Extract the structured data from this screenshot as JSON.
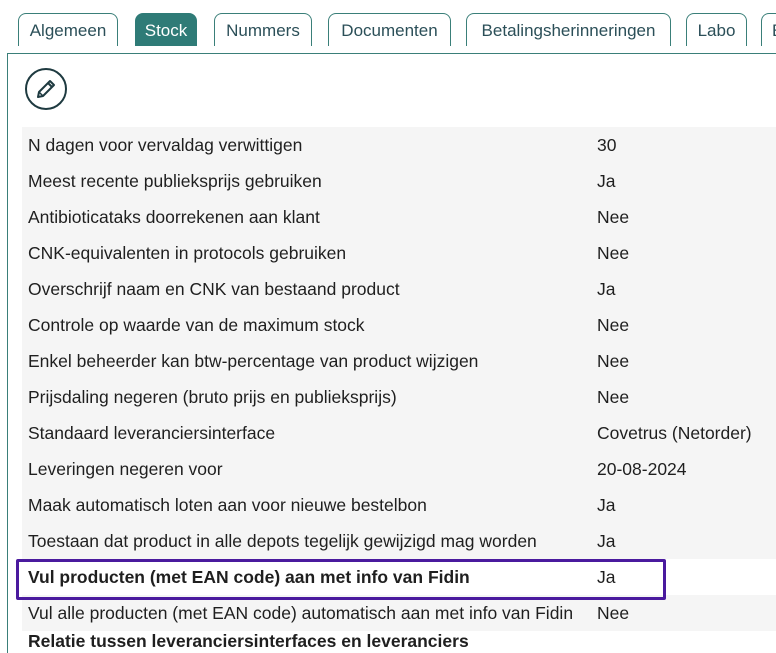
{
  "tabs": [
    {
      "label": "Algemeen",
      "active": false
    },
    {
      "label": "Stock",
      "active": true
    },
    {
      "label": "Nummers",
      "active": false
    },
    {
      "label": "Documenten",
      "active": false
    },
    {
      "label": "Betalingsherinneringen",
      "active": false
    },
    {
      "label": "Labo",
      "active": false
    },
    {
      "label": "E",
      "active": false
    }
  ],
  "edit_icon": "pencil-icon",
  "settings": [
    {
      "label": "N dagen voor vervaldag verwittigen",
      "value": "30"
    },
    {
      "label": "Meest recente publieksprijs gebruiken",
      "value": "Ja"
    },
    {
      "label": "Antibioticataks doorrekenen aan klant",
      "value": "Nee"
    },
    {
      "label": "CNK-equivalenten in protocols gebruiken",
      "value": "Nee"
    },
    {
      "label": "Overschrijf naam en CNK van bestaand product",
      "value": "Ja"
    },
    {
      "label": "Controle op waarde van de maximum stock",
      "value": "Nee"
    },
    {
      "label": "Enkel beheerder kan btw-percentage van product wijzigen",
      "value": "Nee"
    },
    {
      "label": "Prijsdaling negeren (bruto prijs en publieksprijs)",
      "value": "Nee"
    },
    {
      "label": "Standaard leveranciersinterface",
      "value": "Covetrus (Netorder)"
    },
    {
      "label": "Leveringen negeren voor",
      "value": "20-08-2024"
    },
    {
      "label": "Maak automatisch loten aan voor nieuwe bestelbon",
      "value": "Ja"
    },
    {
      "label": "Toestaan dat product in alle depots tegelijk gewijzigd mag worden",
      "value": "Ja"
    },
    {
      "label": "Vul producten (met EAN code) aan met info van Fidin",
      "value": "Ja"
    },
    {
      "label": "Vul alle producten (met EAN code) automatisch aan met info van Fidin",
      "value": "Nee"
    }
  ],
  "section_heading": "Relatie tussen leveranciersinterfaces en leveranciers",
  "colors": {
    "accent": "#2f7b77",
    "highlight": "#4a1a9e",
    "row_bg": "#f5f5f5"
  }
}
